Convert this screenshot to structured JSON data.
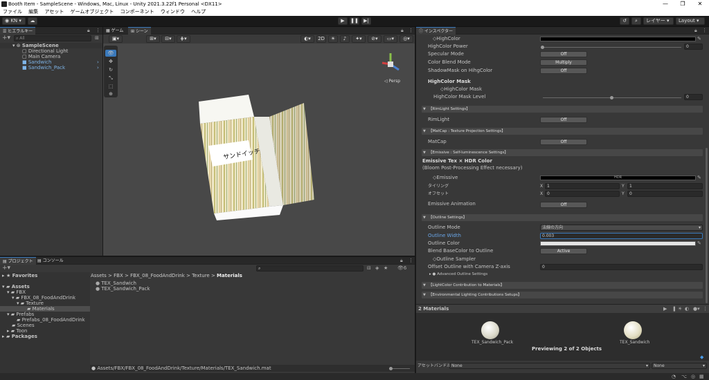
{
  "window": {
    "title": "Booth Item - SampleScene - Windows, Mac, Linux - Unity 2021.3.22f1 Personal <DX11>"
  },
  "menu": [
    "ファイル",
    "編集",
    "アセット",
    "ゲームオブジェクト",
    "コンポーネント",
    "ウィンドウ",
    "ヘルプ"
  ],
  "toolbar": {
    "account": "KN",
    "layers": "レイヤー",
    "layout": "Layout"
  },
  "hierarchy": {
    "tab": "ヒエラルキー",
    "search": "All",
    "items": [
      "SampleScene",
      "Directional Light",
      "Main Camera",
      "Sandwich",
      "Sandwich_Pack"
    ]
  },
  "scene": {
    "tabs": [
      "ゲーム",
      "シーン"
    ],
    "mode2d": "2D",
    "persp": "◁ Persp",
    "label": "サンドイッチ"
  },
  "project": {
    "tabs": [
      "プロジェクト",
      "コンソール"
    ],
    "favorites": "Favorites",
    "tree": [
      "Assets",
      "FBX",
      "FBX_08_FoodAndDrink",
      "Texture",
      "Materials",
      "Prefabs",
      "Prefabs_08_FoodAndDrink",
      "Scenes",
      "Toon",
      "Packages"
    ],
    "breadcrumb": [
      "Assets",
      "FBX",
      "FBX_08_FoodAndDrink",
      "Texture",
      "Materials"
    ],
    "files": [
      "TEX_Sandwich",
      "TEX_Sandwich_Pack"
    ],
    "status": "Assets/FBX/FBX_08_FoodAndDrink/Texture/Materials/TEX_Sandwich.mat",
    "count": "6"
  },
  "inspector": {
    "tab": "インスペクター",
    "highcolor": "HighColor",
    "highcolor_power": "HighColor Power",
    "highcolor_power_val": "0",
    "specular": "Specular Mode",
    "off": "Off",
    "blend": "Color Blend Mode",
    "multiply": "Multiply",
    "shadowmask": "ShadowMask on HihgColor",
    "hcmask_title": "HighColor Mask",
    "hcmask": "HighColor Mask",
    "hcmask_level": "HighColor Mask Level",
    "hcmask_level_val": "0",
    "sec_rim": "【RimLight Settings】",
    "rimlight": "RimLight",
    "sec_matcap": "【MatCap : Texture Projection Settings】",
    "matcap": "MatCap",
    "sec_emissive": "【Emissive : Self-luminescence Settings】",
    "emissive_title": "Emissive Tex × HDR Color",
    "emissive_sub": "(Bloom Post-Processing Effect necessary)",
    "emissive": "Emissive",
    "hdr": "HDR",
    "tiling": "タイリング",
    "offset": "オフセット",
    "x": "X",
    "y": "Y",
    "one": "1",
    "zero": "0",
    "emissive_anim": "Emissive Animation",
    "sec_outline": "【Outline Settings】",
    "outline_mode": "Outline Mode",
    "outline_mode_val": "法線の方向",
    "outline_width": "Outline Width",
    "outline_width_val": "0.003",
    "outline_color": "Outline Color",
    "blend_base": "Blend BaseColor to Outline",
    "active": "Active",
    "outline_sampler": "Outline Sampler",
    "offset_cam": "Offset Outline with Camera Z-axis",
    "offset_cam_val": "0",
    "adv_outline": "● Advanced Outline Settings",
    "sec_lightcolor": "【LightColor Contribution to Materials】",
    "sec_env": "【Environmental Lighting Contributions Setups】",
    "materials_hdr": "2 Materials",
    "mat1": "TEX_Sandwich_Pack",
    "mat2": "TEX_Sandwich",
    "previewing": "Previewing 2 of 2 Objects",
    "bundle_label": "アセットバンドル",
    "none1": "None",
    "none2": "None"
  },
  "colors": {
    "accent": "#3a79bb",
    "selection": "#2c5d87",
    "panel": "#383838",
    "dark": "#191919"
  }
}
